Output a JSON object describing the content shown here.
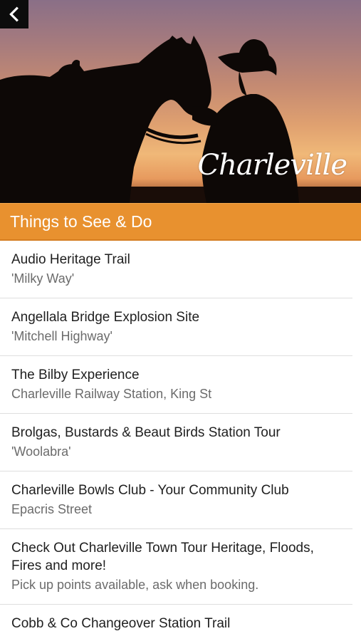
{
  "hero": {
    "logo_text": "Charleville",
    "back_icon": "chevron-left-icon"
  },
  "section": {
    "title": "Things to See & Do"
  },
  "items": [
    {
      "title": "Audio Heritage Trail",
      "subtitle": "'Milky Way'"
    },
    {
      "title": "Angellala Bridge Explosion Site",
      "subtitle": "'Mitchell Highway'"
    },
    {
      "title": "The Bilby Experience",
      "subtitle": "Charleville Railway Station, King St"
    },
    {
      "title": "Brolgas, Bustards & Beaut Birds Station Tour",
      "subtitle": "'Woolabra'"
    },
    {
      "title": "Charleville Bowls Club - Your Community Club",
      "subtitle": "Epacris Street"
    },
    {
      "title": "Check Out Charleville Town Tour Heritage, Floods, Fires and more!",
      "subtitle": "Pick up points available, ask when booking."
    },
    {
      "title": "Cobb & Co Changeover Station Trail",
      "subtitle": ""
    }
  ],
  "colors": {
    "accent": "#e8912f",
    "back_button_bg": "#0c0c0c",
    "title_text": "#1f1f1f",
    "subtitle_text": "#6b6b6b"
  }
}
